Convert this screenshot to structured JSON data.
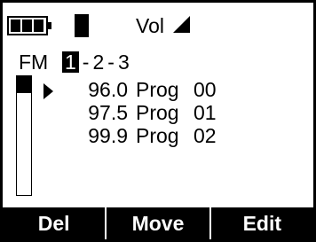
{
  "status": {
    "battery_icon": "battery-icon",
    "battery_level": 0.75,
    "signal_icon": "signal-icon",
    "volume_label": "Vol",
    "volume_icon": "volume-triangle-icon"
  },
  "band": {
    "label": "FM"
  },
  "presets": {
    "items": [
      "1",
      "2",
      "3"
    ],
    "separator": "-",
    "selected": "1"
  },
  "scroll": {
    "position_fraction": 0.14
  },
  "stations": [
    {
      "freq": "96.0",
      "label": "Prog",
      "num": "00"
    },
    {
      "freq": "97.5",
      "label": "Prog",
      "num": "01"
    },
    {
      "freq": "99.9",
      "label": "Prog",
      "num": "02"
    }
  ],
  "softkeys": {
    "del": "Del",
    "move": "Move",
    "edit": "Edit"
  },
  "colors": {
    "foreground": "#000000",
    "background": "#ffffff"
  }
}
